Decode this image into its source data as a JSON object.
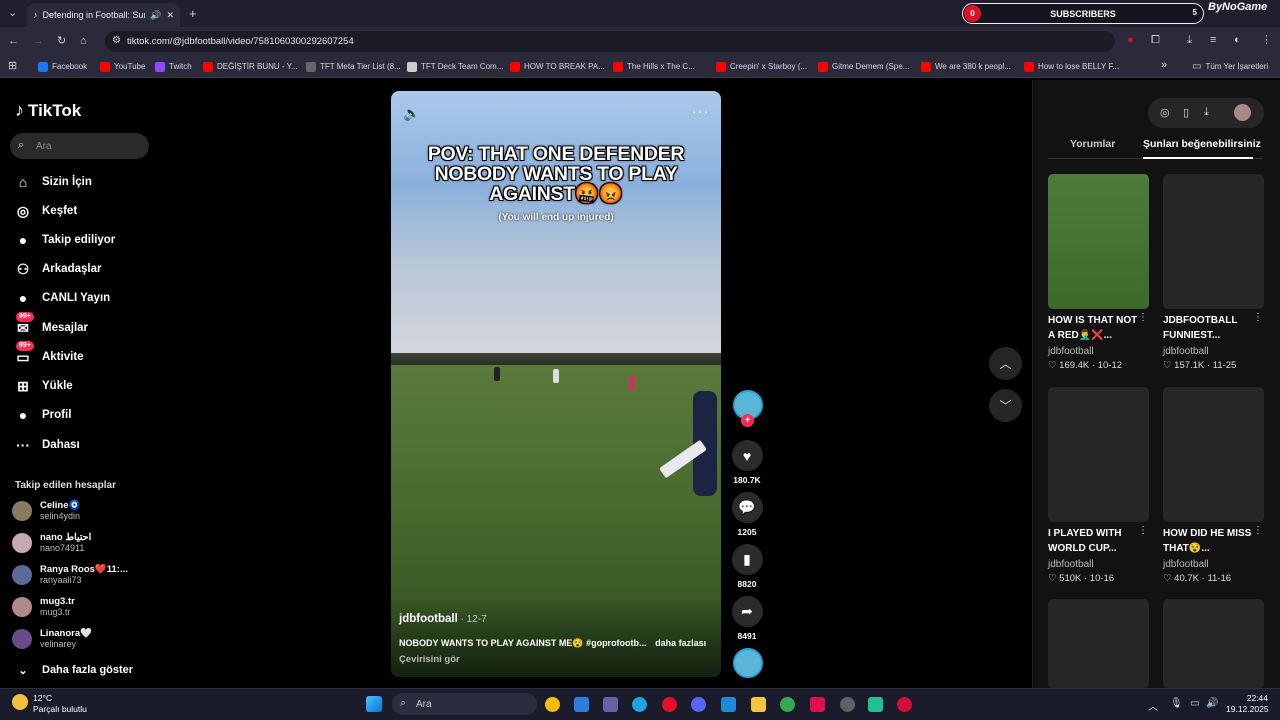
{
  "browser": {
    "tab_title": "Defending in Football: Sund",
    "url": "tiktok.com/@jdbfootball/video/7581060300292607254",
    "bookmarks": [
      {
        "label": "Facebook",
        "color": "#1877f2"
      },
      {
        "label": "YouTube",
        "color": "#ff0000"
      },
      {
        "label": "Twitch",
        "color": "#9146ff"
      },
      {
        "label": "DEĞİŞTİR BUNU - Y...",
        "color": "#ff0000"
      },
      {
        "label": "TFT Meta Tier List (8...",
        "color": "#666666"
      },
      {
        "label": "TFT Deck Team Com...",
        "color": "#cccccc"
      },
      {
        "label": "HOW TO BREAK PA...",
        "color": "#ff0000"
      },
      {
        "label": "The Hills x The C...",
        "color": "#ff0000"
      },
      {
        "label": "Creepin' x Starboy (...",
        "color": "#ff0000"
      },
      {
        "label": "Gitme Demem (Spe...",
        "color": "#ff0000"
      },
      {
        "label": "We are 380 k peopl...",
        "color": "#ff0000"
      },
      {
        "label": "How to lose BELLY F...",
        "color": "#ff0000"
      }
    ],
    "all_bookmarks": "Tüm Yer İşaretleri"
  },
  "subs_widget": {
    "label": "SUBSCRIBERS",
    "left_count": "0",
    "right_count": "5",
    "brand": "ByNoGame"
  },
  "sidebar": {
    "logo": "TikTok",
    "search_placeholder": "Ara",
    "nav": [
      {
        "label": "Sizin İçin",
        "icon": "home-icon",
        "glyph": "⌂"
      },
      {
        "label": "Keşfet",
        "icon": "compass-icon",
        "glyph": "◎"
      },
      {
        "label": "Takip ediliyor",
        "icon": "following-avatar-icon",
        "glyph": "●"
      },
      {
        "label": "Arkadaşlar",
        "icon": "friends-icon",
        "glyph": "⚇"
      },
      {
        "label": "CANLI Yayın",
        "icon": "live-icon",
        "glyph": "●"
      },
      {
        "label": "Mesajlar",
        "icon": "message-icon",
        "glyph": "✉",
        "badge": "99+"
      },
      {
        "label": "Aktivite",
        "icon": "activity-icon",
        "glyph": "▭",
        "badge": "99+"
      },
      {
        "label": "Yükle",
        "icon": "upload-icon",
        "glyph": "⊞"
      },
      {
        "label": "Profil",
        "icon": "profile-icon",
        "glyph": "●"
      },
      {
        "label": "Dahası",
        "icon": "more-icon",
        "glyph": "···"
      }
    ],
    "following_title": "Takip edilen hesaplar",
    "following": [
      {
        "name": "Celine🧿",
        "user": "selin4ydin",
        "color": "#8a7a60"
      },
      {
        "name": "nano احتياط",
        "user": "nano74911",
        "color": "#c9a9b0"
      },
      {
        "name": "Ranya Roos❤️11:...",
        "user": "ranyaali73",
        "color": "#5a6a9a"
      },
      {
        "name": "mug3.tr",
        "user": "mug3.tr",
        "color": "#b08a8a"
      },
      {
        "name": "Linanora🤍",
        "user": "velinarey",
        "color": "#6a4a8a"
      }
    ],
    "show_more": "Daha fazla göster"
  },
  "video": {
    "title": "POV: THAT ONE DEFENDER NOBODY WANTS TO PLAY AGAINST🤬😡",
    "subtitle": "(You will end up injured)",
    "author": "jdbfootball",
    "date": " · 12-7",
    "description": "NOBODY WANTS TO PLAY AGAINST ME😵 #goprofootb...",
    "more": "daha fazlası",
    "translate": "Çevirisini gör"
  },
  "actions": {
    "likes": "180.7K",
    "comments": "1205",
    "saves": "8820",
    "shares": "8491"
  },
  "right_panel": {
    "tab_comments": "Yorumlar",
    "tab_recommended": "Şunları beğenebilirsiniz",
    "cards": [
      {
        "title": "HOW IS THAT NOT A RED🤦‍♂️❌...",
        "author": "jdbfootball",
        "likes": "169.4K",
        "date": "10-12"
      },
      {
        "title": "JDBFOOTBALL FUNNIEST...",
        "author": "jdbfootball",
        "likes": "157.1K",
        "date": "11-25"
      },
      {
        "title": "I PLAYED WITH WORLD CUP...",
        "author": "jdbfootball",
        "likes": "510K",
        "date": "10-16"
      },
      {
        "title": "HOW DID HE MISS THAT😵...",
        "author": "jdbfootball",
        "likes": "40.7K",
        "date": "11-16"
      }
    ]
  },
  "taskbar": {
    "temp": "12°C",
    "weather": "Parçalı bulutlu",
    "search": "Ara",
    "time": "22:44",
    "date": "19.12.2025"
  }
}
